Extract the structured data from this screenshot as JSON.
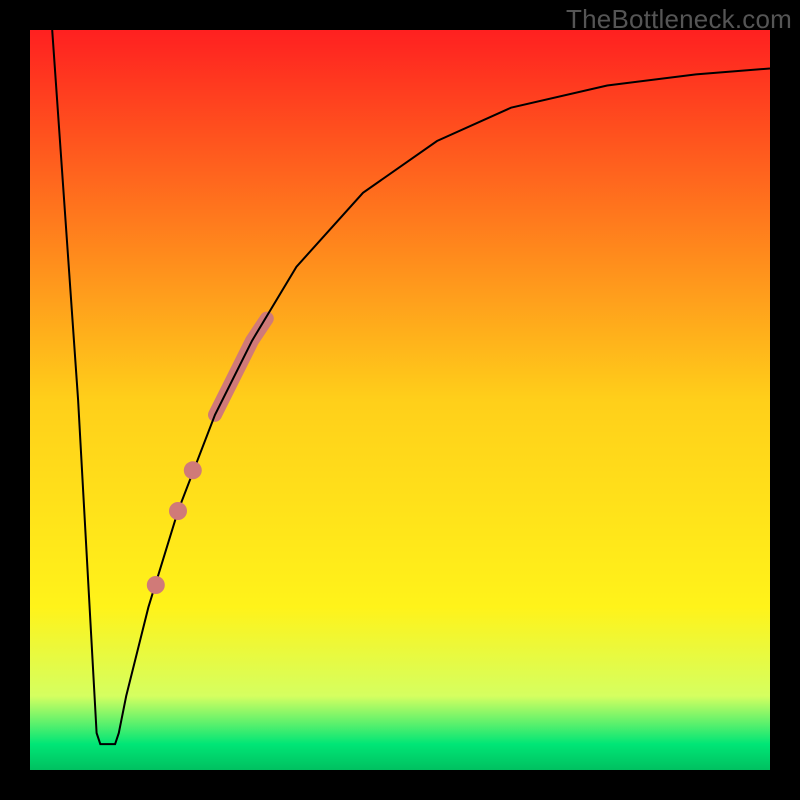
{
  "watermark": "TheBottleneck.com",
  "chart_data": {
    "type": "line",
    "title": "",
    "xlabel": "",
    "ylabel": "",
    "xlim": [
      0,
      100
    ],
    "ylim": [
      0,
      100
    ],
    "background_gradient": {
      "stops": [
        {
          "offset": 0.0,
          "color": "#ff2020"
        },
        {
          "offset": 0.5,
          "color": "#ffcf1a"
        },
        {
          "offset": 0.78,
          "color": "#fff31a"
        },
        {
          "offset": 0.9,
          "color": "#d5ff60"
        },
        {
          "offset": 0.965,
          "color": "#00e676"
        },
        {
          "offset": 1.0,
          "color": "#00c060"
        }
      ]
    },
    "series": [
      {
        "name": "curve",
        "type": "line",
        "color": "#000000",
        "width": 2,
        "points": [
          {
            "x": 3.0,
            "y": 100.0
          },
          {
            "x": 6.5,
            "y": 50.0
          },
          {
            "x": 8.5,
            "y": 14.0
          },
          {
            "x": 9.0,
            "y": 5.0
          },
          {
            "x": 9.5,
            "y": 3.5
          },
          {
            "x": 11.5,
            "y": 3.5
          },
          {
            "x": 12.0,
            "y": 5.0
          },
          {
            "x": 13.0,
            "y": 10.0
          },
          {
            "x": 16.0,
            "y": 22.0
          },
          {
            "x": 20.0,
            "y": 35.0
          },
          {
            "x": 25.0,
            "y": 48.0
          },
          {
            "x": 30.0,
            "y": 58.0
          },
          {
            "x": 36.0,
            "y": 68.0
          },
          {
            "x": 45.0,
            "y": 78.0
          },
          {
            "x": 55.0,
            "y": 85.0
          },
          {
            "x": 65.0,
            "y": 89.5
          },
          {
            "x": 78.0,
            "y": 92.5
          },
          {
            "x": 90.0,
            "y": 94.0
          },
          {
            "x": 100.0,
            "y": 94.8
          }
        ]
      },
      {
        "name": "highlight-band",
        "type": "line",
        "color": "#d07a78",
        "width": 14,
        "linecap": "round",
        "points": [
          {
            "x": 25.0,
            "y": 48.0
          },
          {
            "x": 30.0,
            "y": 58.0
          },
          {
            "x": 32.0,
            "y": 61.0
          }
        ]
      },
      {
        "name": "dots",
        "type": "scatter",
        "color": "#d07a78",
        "radius": 9,
        "points": [
          {
            "x": 22.0,
            "y": 40.5
          },
          {
            "x": 20.0,
            "y": 35.0
          },
          {
            "x": 17.0,
            "y": 25.0
          }
        ]
      }
    ]
  }
}
